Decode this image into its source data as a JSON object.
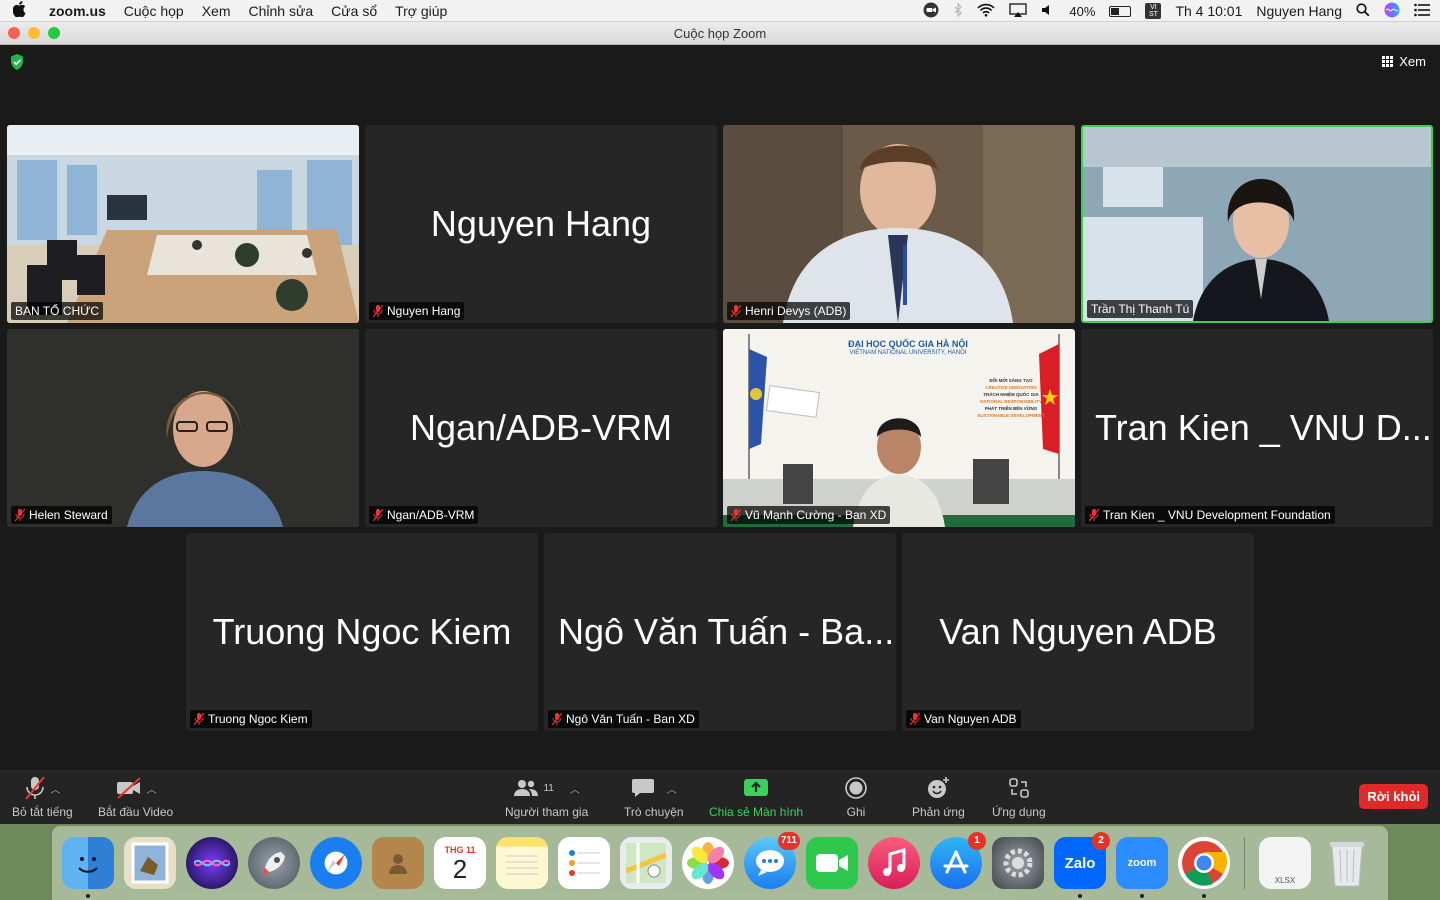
{
  "menubar": {
    "app_name": "zoom.us",
    "menus": [
      "Cuộc họp",
      "Xem",
      "Chỉnh sửa",
      "Cửa sổ",
      "Trợ giúp"
    ],
    "battery_percent": "40%",
    "input_source": "VI ST",
    "clock": "Th 4 10:01",
    "user": "Nguyen Hang"
  },
  "window": {
    "title": "Cuộc họp Zoom",
    "view_label": "Xem"
  },
  "tiles": [
    {
      "display_name": "BAN TỔ CHỨC",
      "big_name": "",
      "has_video": true,
      "scene": "conference-room"
    },
    {
      "display_name": "Nguyen Hang",
      "big_name": "Nguyen Hang",
      "has_video": false
    },
    {
      "display_name": "Henri Devys (ADB)",
      "big_name": "",
      "has_video": true,
      "scene": "man-office"
    },
    {
      "display_name": "Trần Thị Thanh Tú",
      "big_name": "",
      "has_video": true,
      "scene": "woman-speaking",
      "active_speaker": true
    },
    {
      "display_name": "Helen Steward",
      "big_name": "",
      "has_video": true,
      "scene": "woman-glasses"
    },
    {
      "display_name": "Ngan/ADB-VRM",
      "big_name": "Ngan/ADB-VRM",
      "has_video": false
    },
    {
      "display_name": "Vũ Mạnh Cường - Ban XD",
      "big_name": "",
      "has_video": true,
      "scene": "vnu-backdrop"
    },
    {
      "display_name": "Tran Kien _ VNU Development Foundation",
      "big_name": "Tran Kien _ VNU D...",
      "has_video": false
    },
    {
      "display_name": "Truong Ngoc Kiem",
      "big_name": "Truong Ngoc Kiem",
      "has_video": false
    },
    {
      "display_name": "Ngô Văn Tuấn - Ban XD",
      "big_name": "Ngô Văn Tuấn - Ba...",
      "has_video": false
    },
    {
      "display_name": "Van Nguyen ADB",
      "big_name": "Van Nguyen ADB",
      "has_video": false
    }
  ],
  "vnu_banner": {
    "title": "ĐẠI HỌC QUỐC GIA HÀ NỘI",
    "subtitle": "VIETNAM NATIONAL UNIVERSITY, HANOI",
    "lines": [
      "ĐỔI MỚI SÁNG TẠO",
      "CREATIVE INNOVATION",
      "TRÁCH NHIỆM QUỐC GIA",
      "NATIONAL RESPONSIBILITY",
      "PHÁT TRIỂN BỀN VỮNG",
      "SUSTAINABLE DEVELOPMENT"
    ]
  },
  "toolbar": {
    "mute_label": "Bỏ tắt tiếng",
    "video_label": "Bắt đầu Video",
    "participants_label": "Người tham gia",
    "participants_count": "11",
    "chat_label": "Trò chuyện",
    "share_label": "Chia sẻ Màn hình",
    "record_label": "Ghi",
    "reactions_label": "Phản ứng",
    "apps_label": "Ứng dụng",
    "leave_label": "Rời khỏi"
  },
  "dock": {
    "calendar_month": "THG 11",
    "calendar_day": "2",
    "messages_badge": "711",
    "appstore_badge": "1",
    "zalo_badge": "2",
    "zalo_label": "Zalo",
    "zoom_label": "zoom",
    "xlsx_label": "XLSX"
  },
  "colors": {
    "active_speaker_border": "#3fcf4f",
    "share_green": "#3ad35a",
    "leave_red": "#e02a2a",
    "tile_bg": "#262626"
  }
}
